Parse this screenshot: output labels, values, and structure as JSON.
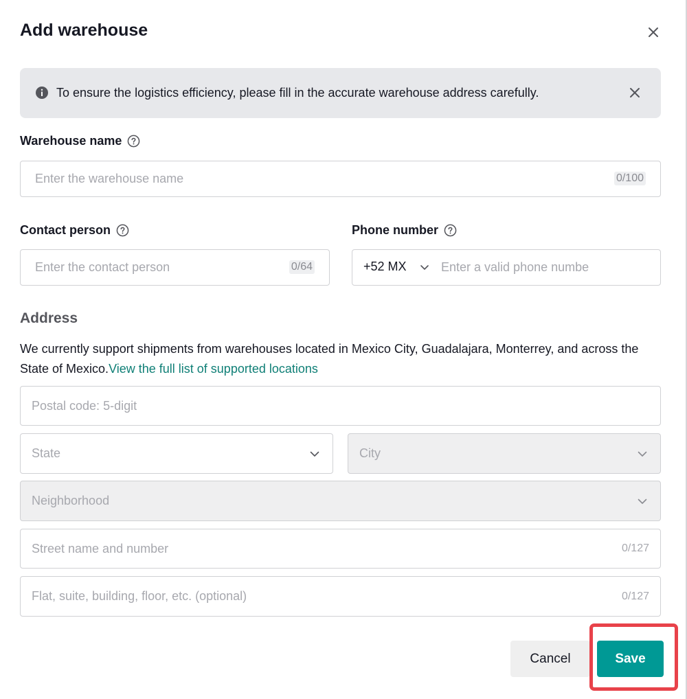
{
  "modal": {
    "title": "Add warehouse"
  },
  "banner": {
    "text": "To ensure the logistics efficiency, please fill in the accurate warehouse address carefully."
  },
  "warehouse_name": {
    "label": "Warehouse name",
    "placeholder": "Enter the warehouse name",
    "value": "",
    "counter": "0/100"
  },
  "contact_person": {
    "label": "Contact person",
    "placeholder": "Enter the contact person",
    "value": "",
    "counter": "0/64"
  },
  "phone": {
    "label": "Phone number",
    "country_code": "+52 MX",
    "placeholder": "Enter a valid phone numbe",
    "value": ""
  },
  "address": {
    "section_title": "Address",
    "description": "We currently support shipments from warehouses located in Mexico City, Guadalajara, Monterrey, and across the State of Mexico.",
    "link_text": "View the full list of supported locations",
    "postal_code_placeholder": "Postal code: 5-digit",
    "state_placeholder": "State",
    "city_placeholder": "City",
    "neighborhood_placeholder": "Neighborhood",
    "street_placeholder": "Street name and number",
    "street_counter": "0/127",
    "flat_placeholder": "Flat, suite, building, floor, etc. (optional)",
    "flat_counter": "0/127"
  },
  "footer": {
    "cancel_label": "Cancel",
    "save_label": "Save"
  },
  "colors": {
    "primary": "#009995",
    "link": "#0f7f76",
    "highlight": "#e8424a",
    "banner_bg": "#e7e8eb"
  },
  "icons": {
    "close": "close-icon",
    "info": "info-icon",
    "help": "help-circle-icon",
    "chevron": "chevron-down-icon"
  }
}
